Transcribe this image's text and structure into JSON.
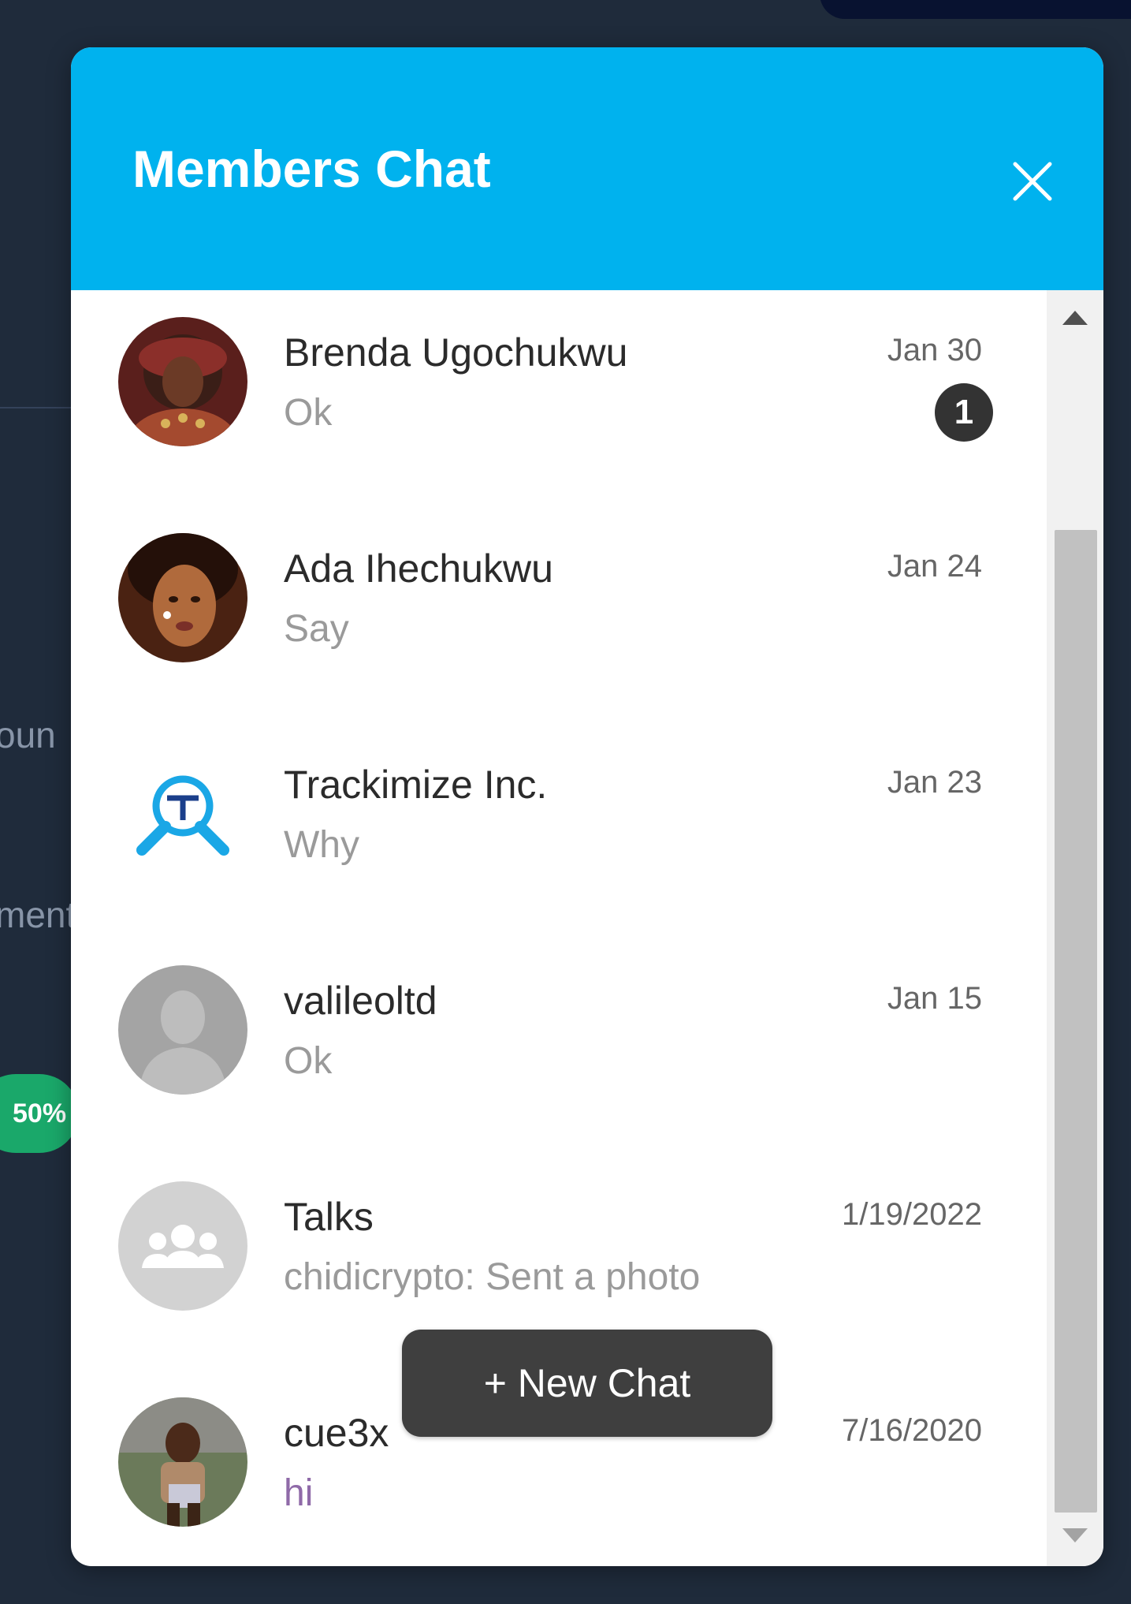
{
  "background": {
    "fragment_1": "oun",
    "fragment_2": "ment",
    "progress_pill": "50%"
  },
  "chat": {
    "title": "Members Chat",
    "close_icon": "close-icon",
    "new_chat_label": "+ New Chat",
    "conversations": [
      {
        "name": "Brenda Ugochukwu",
        "preview": "Ok",
        "date": "Jan 30",
        "unread": "1",
        "avatar": "photo-avatar"
      },
      {
        "name": "Ada Ihechukwu",
        "preview": "Say",
        "date": "Jan 24",
        "avatar": "photo-avatar"
      },
      {
        "name": "Trackimize Inc.",
        "preview": "Why",
        "date": "Jan 23",
        "avatar": "trackimize-logo"
      },
      {
        "name": "valileoltd",
        "preview": "Ok",
        "date": "Jan 15",
        "avatar": "default-user-icon"
      },
      {
        "name": "Talks",
        "preview": "chidicrypto: Sent a photo",
        "date": "1/19/2022",
        "avatar": "group-icon"
      },
      {
        "name": "cue3x",
        "preview": "hi",
        "date": "7/16/2020",
        "avatar": "photo-avatar"
      }
    ]
  },
  "colors": {
    "header": "#00b2ee",
    "page_background": "#1f2b3b",
    "badge": "#333333",
    "button": "#3f3f3f"
  }
}
